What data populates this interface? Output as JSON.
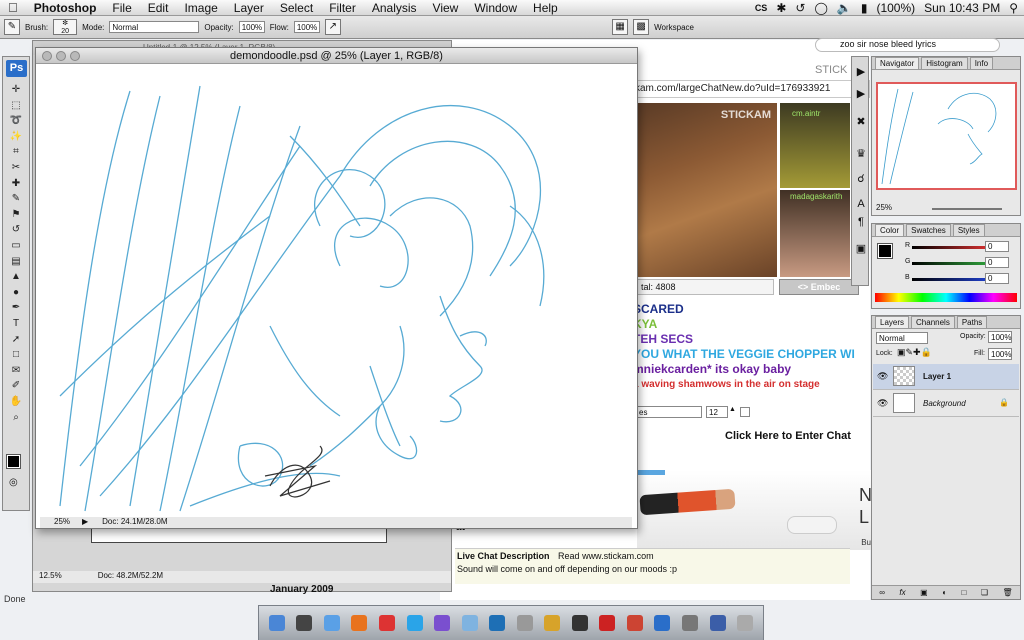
{
  "menubar": {
    "apple": "",
    "app": "Photoshop",
    "items": [
      "File",
      "Edit",
      "Image",
      "Layer",
      "Select",
      "Filter",
      "Analysis",
      "View",
      "Window",
      "Help"
    ],
    "cs_badge": "CS",
    "battery": "(100%)",
    "clock": "Sun 10:43 PM"
  },
  "options": {
    "brush_label": "Brush:",
    "brush_size": "20",
    "mode_label": "Mode:",
    "mode_value": "Normal",
    "opacity_label": "Opacity:",
    "opacity_value": "100%",
    "flow_label": "Flow:",
    "flow_value": "100%",
    "workspace_label": "Workspace"
  },
  "browser": {
    "search_value": "zoo sir nose bleed lyrics",
    "url": "kam.com/largeChatNew.do?uId=176933921",
    "brand": "STICK",
    "video_logo": "STICKAM",
    "user1": "cm.aintr",
    "user2": "madagaskarith",
    "total_label": "tal:",
    "total_value": "4808",
    "embed_label": "<> Embec",
    "chat_lines": [
      {
        "text": "SCARED",
        "color": "#1b2f8a"
      },
      {
        "text": "KYA",
        "color": "#7bbf3a"
      },
      {
        "text": "TEH SECS",
        "color": "#6a2fb0"
      },
      {
        "text": "YOU WHAT THE VEGGIE CHOPPER WI",
        "color": "#2fa8e0"
      },
      {
        "text": "mniekcarden* its okay baby",
        "color": "#6a1fa0"
      },
      {
        "text": "a waving shamwows in the air on stage",
        "color": "#d42f2f"
      }
    ],
    "chat_select": "es",
    "font_size": "12",
    "enter_chat": "Click Here to Enter Chat",
    "ad_letters": "N L",
    "ad_small": "Bu",
    "chat_desc_label": "Live Chat Description",
    "read_label": "Read www.stickam.com",
    "chat_desc_text": "Sound will come on and off depending on our moods :p",
    "partial_label": "at",
    "status": "Done"
  },
  "documents": {
    "back_title": "Untitled-1 @ 12.5% (Layer 1, RGB/8)",
    "back_zoom": "12.5%",
    "back_doc": "Doc: 48.2M/52.2M",
    "calendar_label": "January 2009",
    "front_title": "demondoodle.psd @ 25% (Layer 1, RGB/8)",
    "front_zoom": "25%",
    "front_doc": "Doc: 24.1M/28.0M"
  },
  "tools": [
    "move",
    "marquee",
    "lasso",
    "magic-wand",
    "crop",
    "slice",
    "healing",
    "brush",
    "stamp",
    "history-brush",
    "eraser",
    "gradient",
    "blur",
    "dodge",
    "pen",
    "type",
    "path-select",
    "shape",
    "notes",
    "eyedropper",
    "hand",
    "zoom"
  ],
  "panels": {
    "navigator_tabs": [
      "Navigator",
      "Histogram",
      "Info"
    ],
    "nav_zoom": "25%",
    "color_tabs": [
      "Color",
      "Swatches",
      "Styles"
    ],
    "r_label": "R",
    "g_label": "G",
    "b_label": "B",
    "r_value": "0",
    "g_value": "0",
    "b_value": "0",
    "layers_tabs": [
      "Layers",
      "Channels",
      "Paths"
    ],
    "blend_mode": "Normal",
    "opacity_label": "Opacity:",
    "opacity_value": "100%",
    "lock_label": "Lock:",
    "fill_label": "Fill:",
    "fill_value": "100%",
    "layers": [
      {
        "name": "Layer 1",
        "selected": true
      },
      {
        "name": "Background",
        "selected": false
      }
    ]
  },
  "dock": [
    "finder",
    "dashboard",
    "safari",
    "firefox",
    "ical",
    "skype",
    "itunes",
    "mail",
    "cisco",
    "network",
    "preview",
    "terminal",
    "acrobat",
    "cs4",
    "photoshop",
    "system-prefs",
    "vpn",
    "trash"
  ],
  "colors": {
    "sketch_blue": "#3a9ccc",
    "ps_blue": "#2a6ec9",
    "red_slider": "#d32f2f",
    "green_slider": "#2e9e3a",
    "blue_slider": "#1f3fc9"
  }
}
